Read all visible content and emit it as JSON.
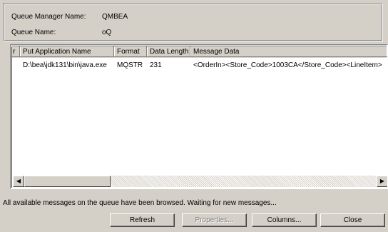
{
  "queue_info": {
    "manager_label": "Queue Manager Name:",
    "manager_value": "QMBEA",
    "queue_label": "Queue Name:",
    "queue_value": "oQ"
  },
  "table": {
    "columns": [
      "r",
      "Put Application Name",
      "Format",
      "Data Length",
      "Message Data"
    ],
    "rows": [
      [
        "",
        "D:\\bea\\jdk131\\bin\\java.exe",
        "MQSTR",
        "231",
        "<OrderIn><Store_Code>1003CA</Store_Code><LineItem>"
      ]
    ]
  },
  "status_text": "All available messages on the queue have been browsed. Waiting for new messages...",
  "buttons": {
    "refresh": "Refresh",
    "properties": "Properties...",
    "columns": "Columns...",
    "close": "Close"
  },
  "icons": {
    "scroll_left": "left-arrow-icon",
    "scroll_right": "right-arrow-icon"
  }
}
